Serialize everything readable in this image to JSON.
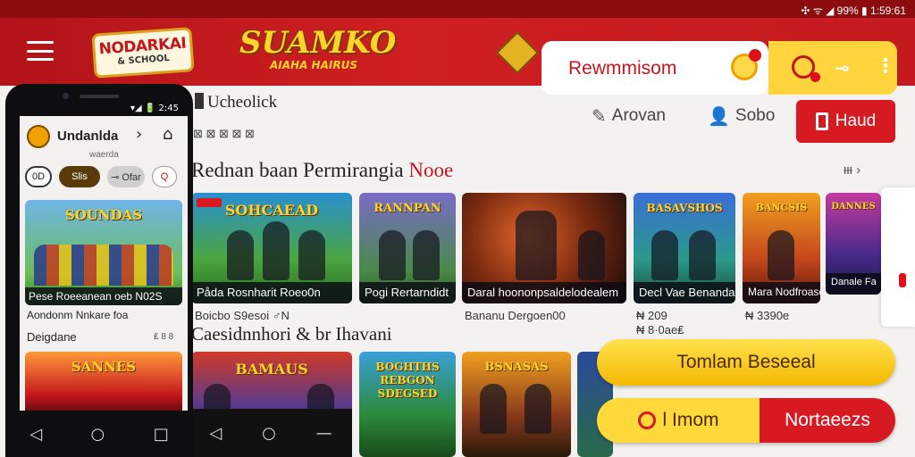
{
  "status_bar": {
    "right_text": "✣ ᯤ ◢ 99% ▮ 1:59:61"
  },
  "header": {
    "logo_left_line1": "NODARKAI",
    "logo_left_line2": "& SCHOOL",
    "logo_center_line1": "SUAMKO",
    "logo_center_line2": "AIAHA HAIRUS",
    "search_label": "Rewmmisom",
    "action_tag": "⊸",
    "action_more": "⋮"
  },
  "toolbar": {
    "crumb": "Ucheolick",
    "sub": "⊠ ⊠ ⊠ ⊠ ⊠",
    "action1_label": "Arovan",
    "action2_label": "Sobo",
    "primary_label": "Haud"
  },
  "section1": {
    "title_main": "Rednan baan Permirangia ",
    "title_accent": "Nooe",
    "see_all": "ᵻᵻᵻ  ›",
    "cards": [
      {
        "logo": "SOHCAEAD",
        "caption": "Påda Rosnharit Roeo0n",
        "meta": "Boicbo S9esoi  ♂N"
      },
      {
        "logo": "RANNPAN",
        "caption": "Pogi Rertarndidt",
        "meta": ""
      },
      {
        "logo": "",
        "caption": "Daral hoononpsaldelodealem",
        "meta": "Bananu Dergoen00"
      },
      {
        "logo": "BASAVSHOS",
        "caption": "Decl Vae Benandan",
        "meta": "₦ 209\n₦ 8·0ae₤"
      },
      {
        "logo": "BANCSIS",
        "caption": "Mara Nodfroaseda",
        "meta": "₦ 3390e"
      },
      {
        "logo": "DANNES",
        "caption": "Danale Fa",
        "meta": ""
      }
    ]
  },
  "section2": {
    "title": "Caesidnnhori & br Ihavani",
    "cards": [
      {
        "logo": "BAMAUS",
        "caption": ""
      },
      {
        "logo": "BOGHTHS\nREBGON\nSDEGSED",
        "caption": ""
      },
      {
        "logo": "BSNASAS",
        "caption": ""
      },
      {
        "logo": "",
        "caption": ""
      }
    ]
  },
  "cta": {
    "primary": "Tomlam Beseeal",
    "secondary_left": "l Imom",
    "secondary_right": "Nortaeezs"
  },
  "phone": {
    "status": "▾◢ 🔋 2:45",
    "app_name": "Undanlda",
    "forward_icon": "›",
    "home_icon": "⌂",
    "sub": "waerda",
    "chips": [
      "0D",
      "Slis",
      "⊸ Ofar",
      "Q"
    ],
    "card_logo": "SOUNDAS",
    "card_caption": "Pese Roeeanean oeb N02S",
    "meta1": "Aondonm Nnkare foa",
    "meta2": "Deigdane",
    "meta3": "₤ 8 8",
    "card2_logo": "SANNES",
    "nav": [
      "◁",
      "○",
      "□"
    ]
  },
  "tablet_nav": [
    "◁",
    "○",
    "—"
  ],
  "colors": {
    "brand_red": "#d71a21",
    "brand_yellow": "#ffd43d",
    "header_red": "#c41a1f"
  }
}
